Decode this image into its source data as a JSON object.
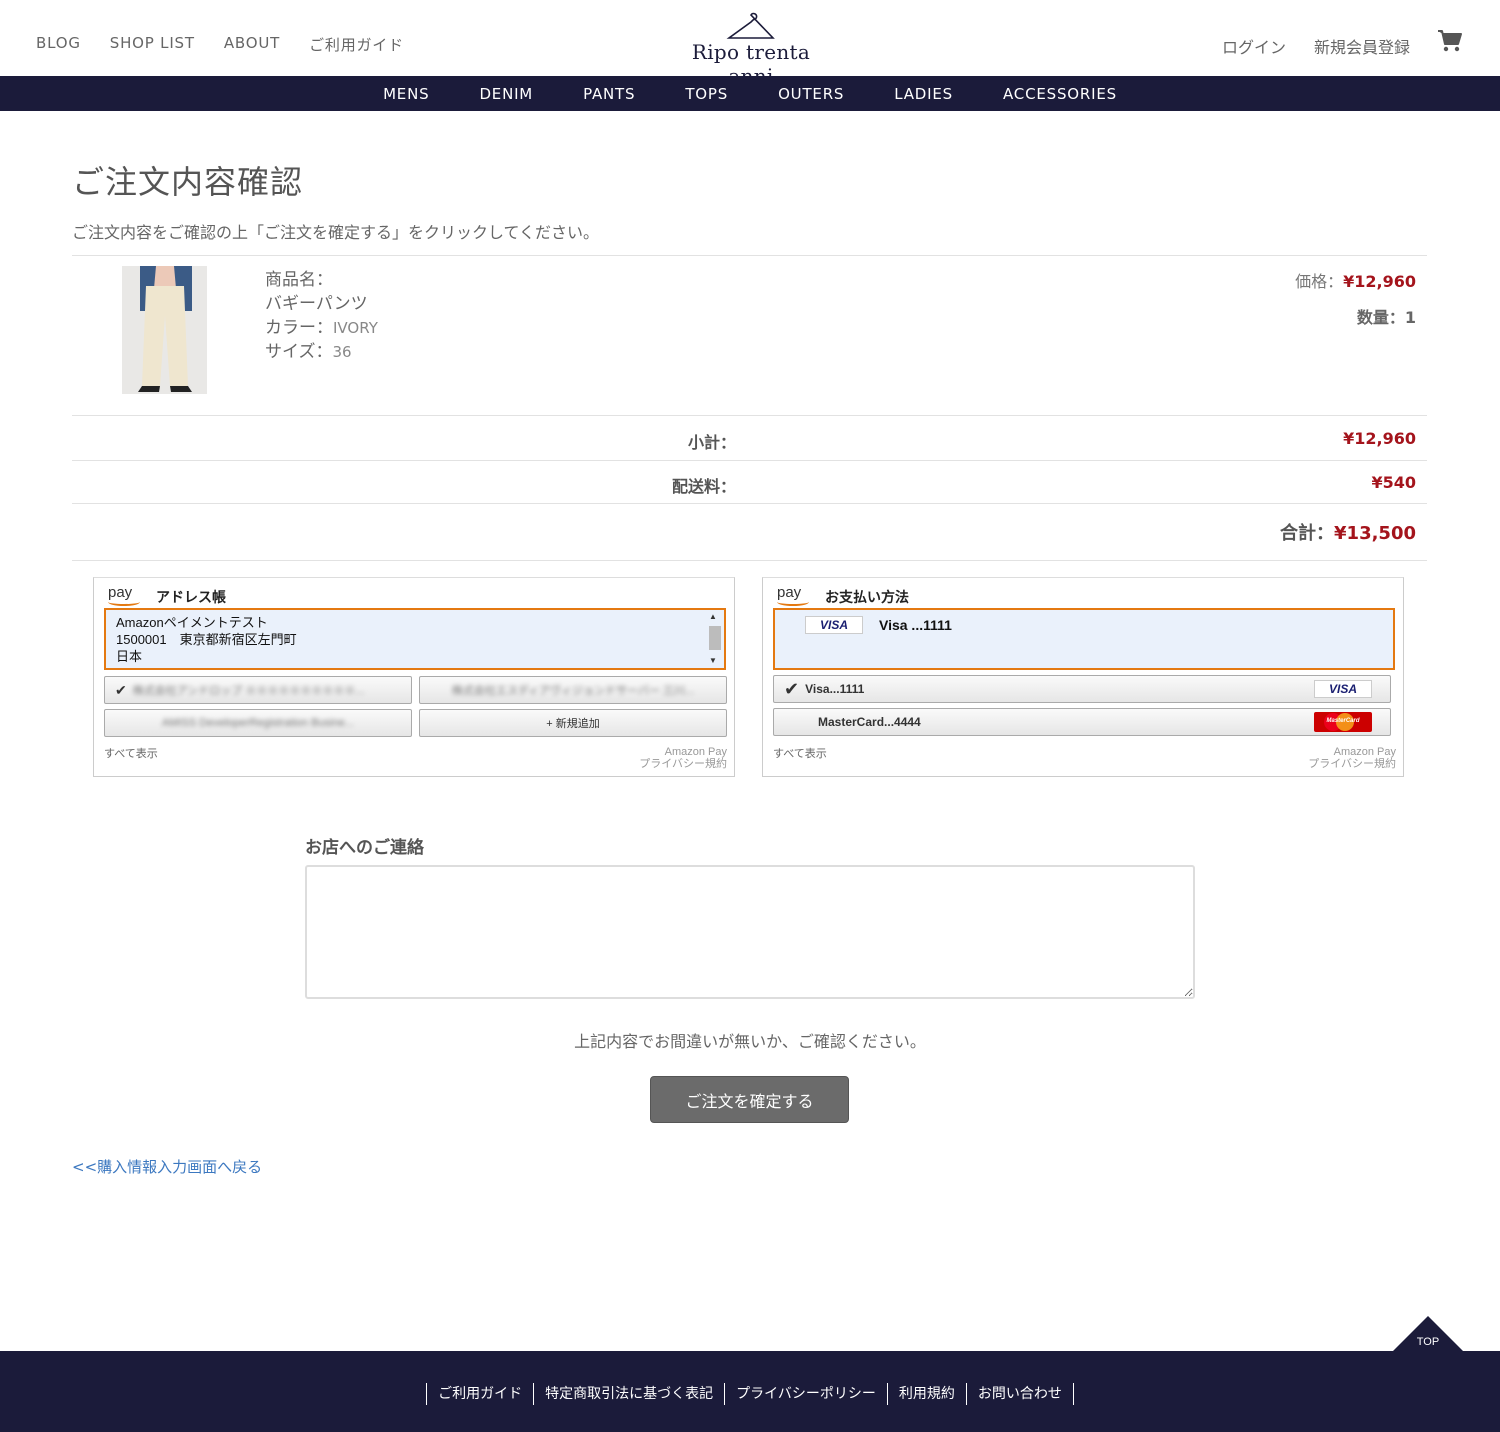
{
  "header": {
    "nav_left": [
      "BLOG",
      "SHOP LIST",
      "ABOUT",
      "ご利用ガイド"
    ],
    "logo": "Ripo trenta anni",
    "nav_right": [
      "ログイン",
      "新規会員登録"
    ],
    "cart_icon": "cart-icon"
  },
  "categories": [
    "MENS",
    "DENIM",
    "PANTS",
    "TOPS",
    "OUTERS",
    "LADIES",
    "ACCESSORIES"
  ],
  "page": {
    "title": "ご注文内容確認",
    "description": "ご注文内容をご確認の上「ご注文を確定する」をクリックしてください。"
  },
  "product": {
    "name_label": "商品名：",
    "name": "バギーパンツ",
    "color_label": "カラー：",
    "color": "IVORY",
    "size_label": "サイズ：",
    "size": "36",
    "price_label": "価格：",
    "price": "¥12,960",
    "qty_label": "数量：",
    "qty": "1"
  },
  "summary": {
    "subtotal_label": "小計：",
    "subtotal": "¥12,960",
    "shipping_label": "配送料：",
    "shipping": "¥540",
    "total_label": "合計：",
    "total": "¥13,500"
  },
  "address_widget": {
    "logo": "pay",
    "title": "アドレス帳",
    "selected_lines": [
      "Amazonペイメントテスト",
      "1500001　東京都新宿区左門町",
      "日本"
    ],
    "options": [
      "株式会社アンドロップ ※※※※※※※※※※...",
      "株式会社エスディアヴィジョンドサーバー 三川...",
      "AMISS DeveloperRegistration Busine..."
    ],
    "add_new": "+ 新規追加",
    "show_all": "すべて表示",
    "privacy_line1": "Amazon Pay",
    "privacy_line2": "プライバシー規約"
  },
  "payment_widget": {
    "logo": "pay",
    "title": "お支払い方法",
    "selected_card": "Visa ...1111",
    "selected_brand": "VISA",
    "options": [
      {
        "label": "Visa...1111",
        "brand": "VISA"
      },
      {
        "label": "MasterCard...4444",
        "brand": "MasterCard"
      }
    ],
    "show_all": "すべて表示",
    "privacy_line1": "Amazon Pay",
    "privacy_line2": "プライバシー規約"
  },
  "contact": {
    "title": "お店へのご連絡",
    "value": ""
  },
  "confirm_message": "上記内容でお間違いが無いか、ご確認ください。",
  "submit_label": "ご注文を確定する",
  "back_link": "<<購入情報入力画面へ戻る",
  "to_top": "TOP",
  "footer_links": [
    "ご利用ガイド",
    "特定商取引法に基づく表記",
    "プライバシーポリシー",
    "利用規約",
    "お問い合わせ"
  ],
  "colors": {
    "navy": "#1b1b3a",
    "price_red": "#a4141c",
    "amazon_orange": "#e47911",
    "link_blue": "#3c78c0"
  }
}
